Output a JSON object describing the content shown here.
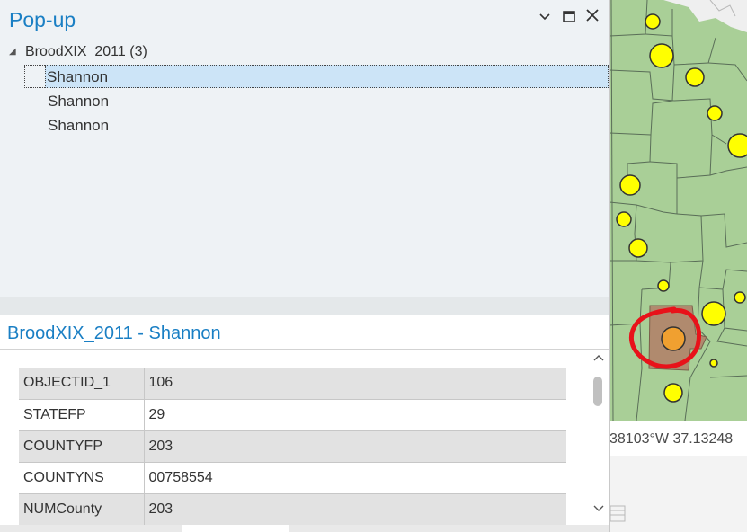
{
  "popup": {
    "title": "Pop-up",
    "controls": {
      "options_icon": "chevron-down-icon",
      "maximize_icon": "maximize-icon",
      "close_icon": "close-icon"
    },
    "tree": {
      "layer_label": "BroodXIX_2011 (3)",
      "items": [
        "Shannon",
        "Shannon",
        "Shannon"
      ],
      "selected_index": 0
    },
    "detail": {
      "title": "BroodXIX_2011 - Shannon",
      "fields": [
        {
          "name": "OBJECTID_1",
          "value": "106"
        },
        {
          "name": "STATEFP",
          "value": "29"
        },
        {
          "name": "COUNTYFP",
          "value": "203"
        },
        {
          "name": "COUNTYNS",
          "value": "00758554"
        },
        {
          "name": "NUMCounty",
          "value": "203"
        }
      ]
    }
  },
  "map": {
    "coordinates": "38103°W 37.13248",
    "colors": {
      "county_fill": "#a9cf97",
      "county_border": "#5a6e58",
      "point_fill": "#ffff00",
      "selected_county": "#b08a6e",
      "selected_point": "#f0a030",
      "annotation_circle": "#e8121a"
    }
  }
}
